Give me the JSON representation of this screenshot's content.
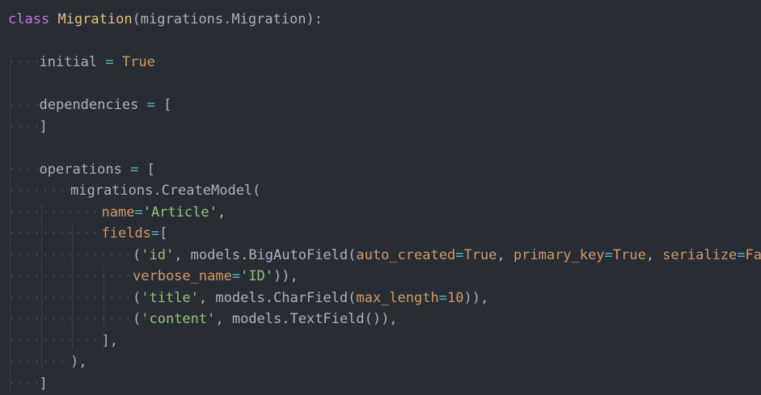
{
  "editor": {
    "language": "python",
    "theme_background": "#282c34",
    "colors": {
      "keyword": "#c678dd",
      "class_name": "#e5c07b",
      "operator": "#56b6c2",
      "boolean": "#d19a66",
      "string": "#98c379",
      "plain": "#abb2bf"
    },
    "lines": [
      {
        "tokens": [
          [
            "kw",
            "class"
          ],
          [
            "txt",
            " "
          ],
          [
            "cls",
            "Migration"
          ],
          [
            "txt",
            "(migrations.Migration):"
          ]
        ]
      },
      {
        "tokens": []
      },
      {
        "tokens": [
          [
            "txt",
            "initial"
          ],
          [
            "txt",
            " "
          ],
          [
            "op",
            "="
          ],
          [
            "txt",
            " "
          ],
          [
            "bool",
            "True"
          ]
        ],
        "indent": 1
      },
      {
        "tokens": []
      },
      {
        "tokens": [
          [
            "txt",
            "dependencies"
          ],
          [
            "txt",
            " "
          ],
          [
            "op",
            "="
          ],
          [
            "txt",
            " ["
          ]
        ],
        "indent": 1
      },
      {
        "tokens": [
          [
            "txt",
            "]"
          ]
        ],
        "indent": 1
      },
      {
        "tokens": []
      },
      {
        "tokens": [
          [
            "txt",
            "operations"
          ],
          [
            "txt",
            " "
          ],
          [
            "op",
            "="
          ],
          [
            "txt",
            " ["
          ]
        ],
        "indent": 1
      },
      {
        "tokens": [
          [
            "txt",
            "migrations.CreateModel("
          ]
        ],
        "indent": 2
      },
      {
        "tokens": [
          [
            "kwarg",
            "name"
          ],
          [
            "op",
            "="
          ],
          [
            "str",
            "'Article'"
          ],
          [
            "txt",
            ","
          ]
        ],
        "indent": 3
      },
      {
        "tokens": [
          [
            "kwarg",
            "fields"
          ],
          [
            "op",
            "="
          ],
          [
            "txt",
            "["
          ]
        ],
        "indent": 3
      },
      {
        "tokens": [
          [
            "txt",
            "("
          ],
          [
            "str",
            "'id'"
          ],
          [
            "txt",
            ", models.BigAutoField("
          ],
          [
            "kwarg",
            "auto_created"
          ],
          [
            "op",
            "="
          ],
          [
            "bool",
            "True"
          ],
          [
            "txt",
            ", "
          ],
          [
            "kwarg",
            "primary_key"
          ],
          [
            "op",
            "="
          ],
          [
            "bool",
            "True"
          ],
          [
            "txt",
            ", "
          ],
          [
            "kwarg",
            "serialize"
          ],
          [
            "op",
            "="
          ],
          [
            "bool",
            "False"
          ],
          [
            "txt",
            ","
          ]
        ],
        "indent": 4
      },
      {
        "tokens": [
          [
            "kwarg",
            "verbose_name"
          ],
          [
            "op",
            "="
          ],
          [
            "str",
            "'ID'"
          ],
          [
            "txt",
            ")),"
          ]
        ],
        "indent": 4
      },
      {
        "tokens": [
          [
            "txt",
            "("
          ],
          [
            "str",
            "'title'"
          ],
          [
            "txt",
            ", models.CharField("
          ],
          [
            "kwarg",
            "max_length"
          ],
          [
            "op",
            "="
          ],
          [
            "bool",
            "10"
          ],
          [
            "txt",
            ")),"
          ]
        ],
        "indent": 4
      },
      {
        "tokens": [
          [
            "txt",
            "("
          ],
          [
            "str",
            "'content'"
          ],
          [
            "txt",
            ", models.TextField()),"
          ]
        ],
        "indent": 4
      },
      {
        "tokens": [
          [
            "txt",
            "],"
          ]
        ],
        "indent": 3
      },
      {
        "tokens": [
          [
            "txt",
            "),"
          ]
        ],
        "indent": 2
      },
      {
        "tokens": [
          [
            "txt",
            "]"
          ]
        ],
        "indent": 1
      }
    ]
  }
}
